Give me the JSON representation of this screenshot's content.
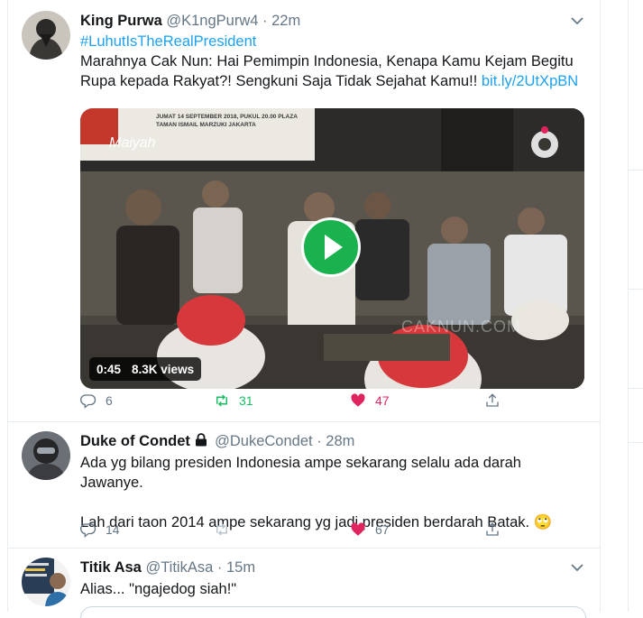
{
  "tweets": [
    {
      "name": "King Purwa",
      "handle": "@K1ngPurw4",
      "dot": "·",
      "time": "22m",
      "hashtag": "#LuhutIsTheRealPresident",
      "text": "Marahnya Cak Nun: Hai Pemimpin Indonesia, Kenapa Kamu Kejam Begitu Rupa kepada Rakyat?! Sengkuni Saja Tidak Sejahat Kamu!!",
      "link": "bit.ly/2UtXpBN",
      "video": {
        "banner_text": "JUMAT 14 SEPTEMBER 2018, PUKUL 20.00 PLAZA TAMAN ISMAIL MARZUKI JAKARTA",
        "logo_text": "Maiyah",
        "watermark": "CAKNUN.COM",
        "duration": "0:45",
        "views": "8.3K views"
      },
      "replies": "6",
      "retweets": "31",
      "likes": "47"
    },
    {
      "name": "Duke of Condet",
      "handle": "@DukeCondet",
      "dot": "·",
      "time": "28m",
      "line1": "Ada yg bilang presiden Indonesia ampe sekarang selalu ada darah Jawanye.",
      "line2": "Lah dari taon 2014 ampe sekarang yg jadi presiden berdarah Batak.",
      "emoji": "🙄",
      "replies": "14",
      "retweets": "",
      "likes": "67"
    },
    {
      "name": "Titik Asa",
      "handle": "@TitikAsa",
      "dot": "·",
      "time": "15m",
      "text": "Alias... \"ngajedog siah!\""
    }
  ],
  "colors": {
    "link": "#1da1f2",
    "retweet_active": "#17bf63",
    "like_active": "#e0245e",
    "secondary_text": "#657786",
    "play_button": "#1ab24f"
  },
  "icons": [
    "chevron-down-icon",
    "reply-icon",
    "retweet-icon",
    "like-icon",
    "share-icon",
    "lock-icon",
    "play-icon",
    "face-with-rolling-eyes-emoji"
  ]
}
